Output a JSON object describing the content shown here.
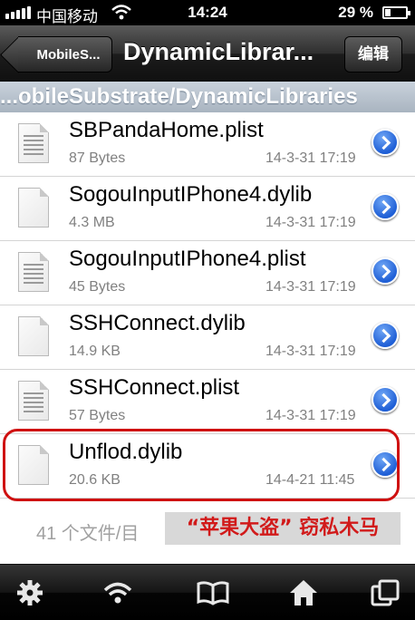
{
  "status_bar": {
    "carrier": "中国移动",
    "time": "14:24",
    "battery": "29 %",
    "battery_level": 0.29
  },
  "nav": {
    "back_label": "MobileS...",
    "title": "DynamicLibrar...",
    "edit_label": "编辑"
  },
  "path": "...obileSubstrate/DynamicLibraries",
  "files": [
    {
      "name": "SBPandaHome.plist",
      "size": "87 Bytes",
      "date": "14-3-31 17:19",
      "type": "plist"
    },
    {
      "name": "SogouInputIPhone4.dylib",
      "size": "4.3 MB",
      "date": "14-3-31 17:19",
      "type": "dylib"
    },
    {
      "name": "SogouInputIPhone4.plist",
      "size": "45 Bytes",
      "date": "14-3-31 17:19",
      "type": "plist"
    },
    {
      "name": "SSHConnect.dylib",
      "size": "14.9 KB",
      "date": "14-3-31 17:19",
      "type": "dylib"
    },
    {
      "name": "SSHConnect.plist",
      "size": "57 Bytes",
      "date": "14-3-31 17:19",
      "type": "plist"
    },
    {
      "name": "Unflod.dylib",
      "size": "20.6 KB",
      "date": "14-4-21 11:45",
      "type": "dylib"
    }
  ],
  "summary": "41 个文件/目",
  "annotation": "“苹果大盗” 窃私木马",
  "colors": {
    "highlight": "#cf1111",
    "annotation_text": "#d11a1a",
    "disclosure": "#1f5fd6"
  },
  "tab_bar": {
    "icons": [
      "gear-icon",
      "wifi-icon",
      "book-icon",
      "home-icon",
      "windows-icon"
    ]
  }
}
